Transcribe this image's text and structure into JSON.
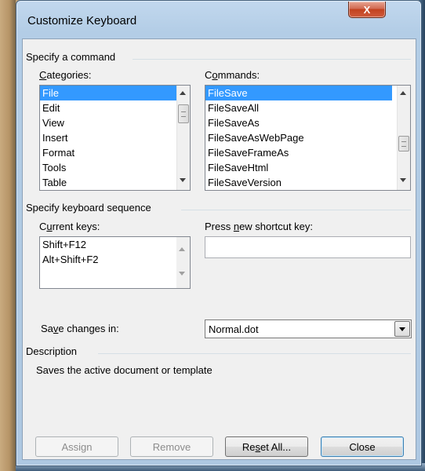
{
  "window": {
    "title": "Customize Keyboard",
    "close_glyph": "X"
  },
  "specify_command": {
    "group_label": "Specify a command",
    "categories": {
      "label": "Categories:",
      "items": [
        "File",
        "Edit",
        "View",
        "Insert",
        "Format",
        "Tools",
        "Table"
      ],
      "selected": "File"
    },
    "commands": {
      "label": "Commands:",
      "items": [
        "FileSave",
        "FileSaveAll",
        "FileSaveAs",
        "FileSaveAsWebPage",
        "FileSaveFrameAs",
        "FileSaveHtml",
        "FileSaveVersion"
      ],
      "selected": "FileSave"
    }
  },
  "keyboard_sequence": {
    "group_label": "Specify keyboard sequence",
    "current_keys_label": "Current keys:",
    "current_keys": [
      "Shift+F12",
      "Alt+Shift+F2"
    ],
    "new_shortcut_label": "Press new shortcut key:",
    "new_shortcut_value": ""
  },
  "save_changes": {
    "label": "Save changes in:",
    "value": "Normal.dot"
  },
  "description": {
    "group_label": "Description",
    "text": "Saves the active document or template"
  },
  "buttons": {
    "assign": "Assign",
    "remove": "Remove",
    "reset_all": "Reset All...",
    "close": "Close"
  },
  "icons": [
    "close-icon",
    "scroll-up-icon",
    "scroll-down-icon",
    "dropdown-arrow-icon"
  ]
}
